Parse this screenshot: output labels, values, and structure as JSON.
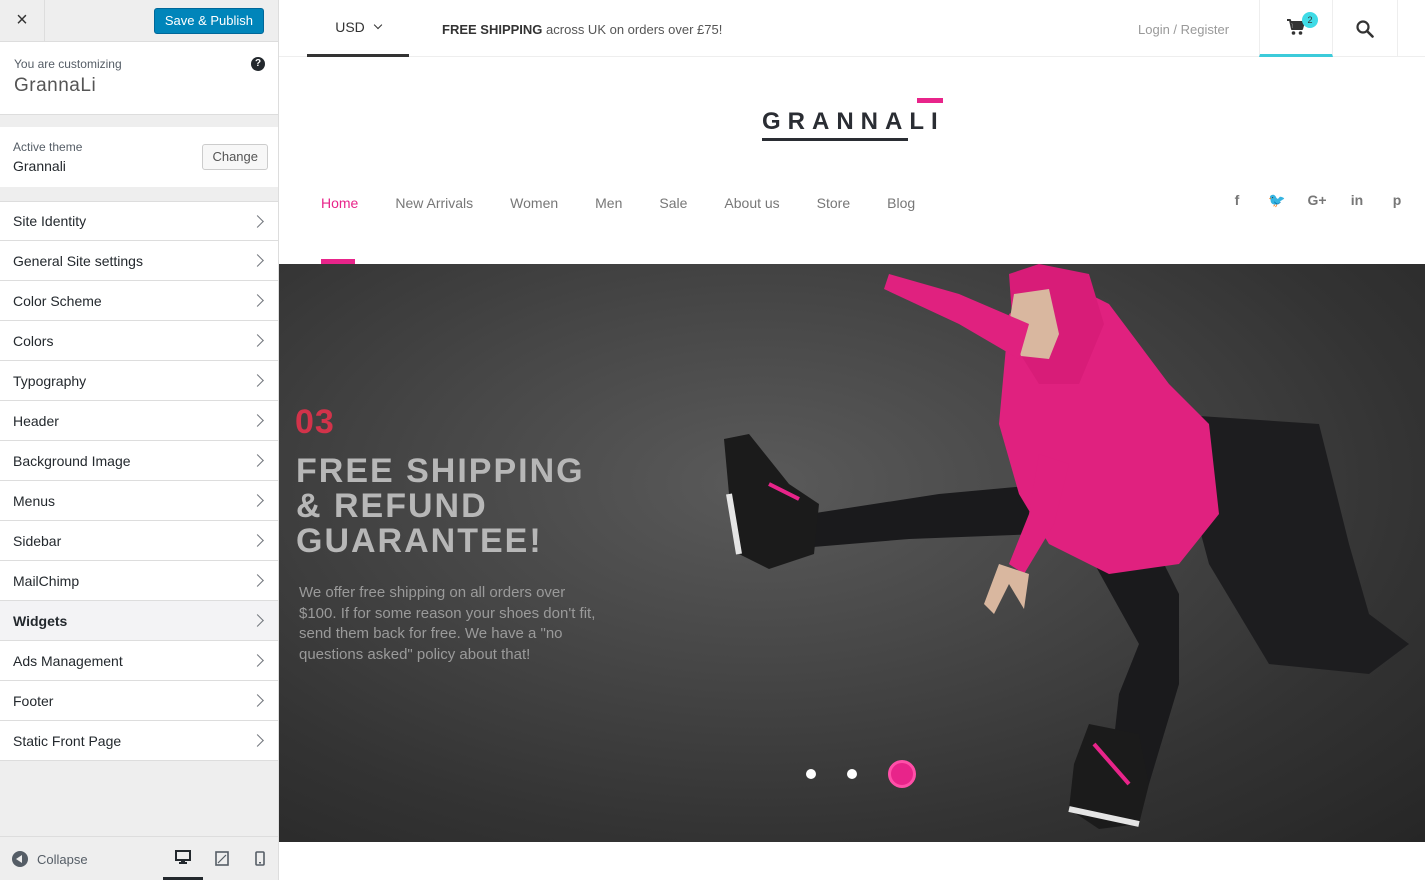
{
  "customizer": {
    "close_label": "×",
    "save_label": "Save & Publish",
    "customizing_label": "You are customizing",
    "site_name": "GrannaLi",
    "help_label": "?",
    "active_theme_label": "Active theme",
    "active_theme_name": "Grannali",
    "change_label": "Change",
    "sections": [
      {
        "label": "Site Identity"
      },
      {
        "label": "General Site settings"
      },
      {
        "label": "Color Scheme"
      },
      {
        "label": "Colors"
      },
      {
        "label": "Typography"
      },
      {
        "label": "Header"
      },
      {
        "label": "Background Image"
      },
      {
        "label": "Menus"
      },
      {
        "label": "Sidebar"
      },
      {
        "label": "MailChimp"
      },
      {
        "label": "Widgets"
      },
      {
        "label": "Ads Management"
      },
      {
        "label": "Footer"
      },
      {
        "label": "Static Front Page"
      }
    ],
    "active_section": "Widgets",
    "collapse_label": "Collapse",
    "devices": [
      "desktop-icon",
      "tablet-icon",
      "mobile-icon"
    ]
  },
  "site": {
    "currency": "USD",
    "shipping_bold": "FREE SHIPPING",
    "shipping_rest": " across UK on orders over £75!",
    "login_label": "Login / Register",
    "cart_count": "2",
    "logo": "GRANNALI",
    "nav": [
      "Home",
      "New Arrivals",
      "Women",
      "Men",
      "Sale",
      "About us",
      "Store",
      "Blog"
    ],
    "nav_active": "Home",
    "socials": [
      {
        "icon": "facebook-icon",
        "glyph": "f"
      },
      {
        "icon": "twitter-icon",
        "glyph": "🐦"
      },
      {
        "icon": "google-plus-icon",
        "glyph": "G+"
      },
      {
        "icon": "linkedin-icon",
        "glyph": "in"
      },
      {
        "icon": "pinterest-icon",
        "glyph": "p"
      }
    ],
    "hero": {
      "number": "03",
      "title_lines": [
        "FREE SHIPPING",
        "& REFUND",
        "GUARANTEE!"
      ],
      "description": "We offer free shipping on all orders over $100. If for some reason your shoes don't fit, send them back for free. We have a \"no questions asked\" policy about that!",
      "slide_count": 3,
      "active_slide": 3
    }
  },
  "colors": {
    "accent": "#e8248a",
    "wp_blue": "#0085ba",
    "cart_accent": "#3ccbda",
    "hero_number": "#d2334a"
  }
}
